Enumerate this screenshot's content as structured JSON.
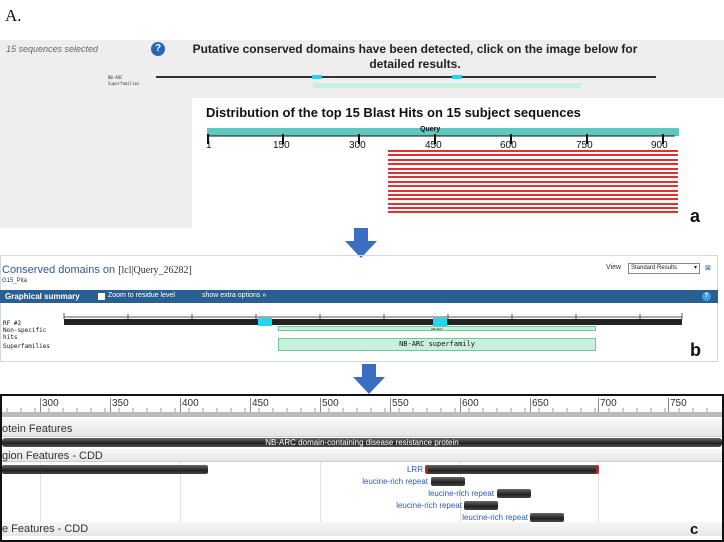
{
  "figure_label": "A.",
  "panel_a": {
    "sequences_selected": "15 sequences selected",
    "help_icon": "help-icon",
    "conserved_message": "Putative conserved domains have been detected, click on the image below for detailed results.",
    "mini_labels": [
      "NB-ARC",
      "Superfamilies"
    ],
    "blast_title": "Distribution of the top 15 Blast Hits on 15 subject sequences",
    "query_label": "Query",
    "axis_ticks": [
      "1",
      "150",
      "300",
      "450",
      "600",
      "750",
      "900"
    ],
    "hit_count": 15,
    "panel_letter": "a"
  },
  "panel_b": {
    "title": "Conserved domains on",
    "query_id": "[lcl|Query_26282]",
    "subtitle": "G15_Pita",
    "view_label": "View",
    "view_value": "Standard Results",
    "graph_title": "Graphical summary",
    "zoom_label": "Zoom to residue level",
    "extra_options": "show extra options »",
    "row_labels": [
      "RF #2",
      "Non-specific",
      "hits",
      "Superfamilies"
    ],
    "superfamily_label": "NB-ARC superfamily",
    "nonspecific_label": "NB-ARC",
    "panel_letter": "b"
  },
  "panel_c": {
    "ruler_ticks": [
      "300",
      "350",
      "400",
      "450",
      "500",
      "550",
      "600",
      "650",
      "700",
      "750"
    ],
    "protein_features_header": "otein Features",
    "protein_bar_label": "NB-ARC domain-containing disease resistance protein",
    "region_header": "gion Features - CDD",
    "features": [
      {
        "label": "LRR"
      },
      {
        "label": "leucine-rich repeat"
      },
      {
        "label": "leucine-rich repeat"
      },
      {
        "label": "leucine-rich repeat"
      },
      {
        "label": "leucine-rich repeat"
      }
    ],
    "site_header": "e Features - CDD",
    "panel_letter": "c"
  },
  "colors": {
    "query_bar": "#5cc8c0",
    "hit_lines": "#e03030",
    "graph_header": "#2a5f92",
    "superfamily_fill": "#c8f0dc",
    "link_blue": "#2a5ab8"
  }
}
